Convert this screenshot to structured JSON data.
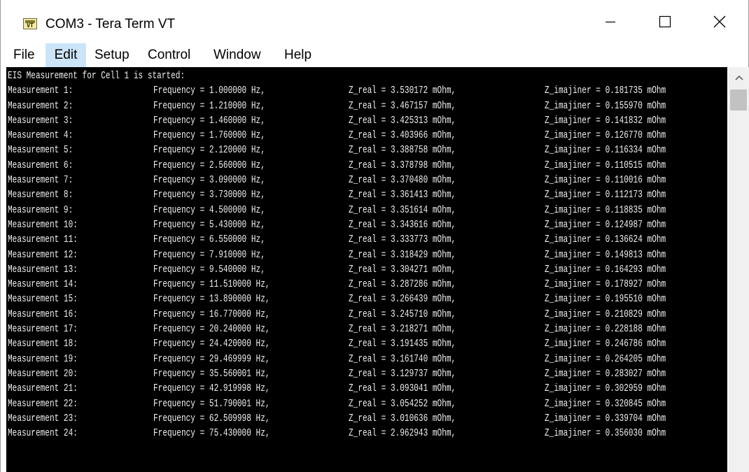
{
  "window": {
    "title": "COM3 - Tera Term VT",
    "icon_text": "VT",
    "icon": "teraterm-app-icon",
    "controls": {
      "minimize_icon": "minimize-icon",
      "maximize_icon": "maximize-icon",
      "close_icon": "close-icon"
    }
  },
  "menu": {
    "items": [
      {
        "label": "File"
      },
      {
        "label": "Edit",
        "selected": true
      },
      {
        "label": "Setup"
      },
      {
        "label": "Control"
      },
      {
        "label": "Window"
      },
      {
        "label": "Help"
      }
    ],
    "selected_color": "#cce4f7"
  },
  "terminal": {
    "background": "#000000",
    "foreground": "#f0f0f0",
    "header": "EIS Measurement for Cell 1 is started:",
    "rows": [
      {
        "label": "Measurement 1:",
        "freq": "Frequency = 1.000000 Hz,",
        "real": "Z_real = 3.530172 mOhm,",
        "imag": "Z_imajiner = 0.181735 mOhm"
      },
      {
        "label": "Measurement 2:",
        "freq": "Frequency = 1.210000 Hz,",
        "real": "Z_real = 3.467157 mOhm,",
        "imag": "Z_imajiner = 0.155970 mOhm"
      },
      {
        "label": "Measurement 3:",
        "freq": "Frequency = 1.460000 Hz,",
        "real": "Z_real = 3.425313 mOhm,",
        "imag": "Z_imajiner = 0.141832 mOhm"
      },
      {
        "label": "Measurement 4:",
        "freq": "Frequency = 1.760000 Hz,",
        "real": "Z_real = 3.403966 mOhm,",
        "imag": "Z_imajiner = 0.126770 mOhm"
      },
      {
        "label": "Measurement 5:",
        "freq": "Frequency = 2.120000 Hz,",
        "real": "Z_real = 3.388758 mOhm,",
        "imag": "Z_imajiner = 0.116334 mOhm"
      },
      {
        "label": "Measurement 6:",
        "freq": "Frequency = 2.560000 Hz,",
        "real": "Z_real = 3.378798 mOhm,",
        "imag": "Z_imajiner = 0.110515 mOhm"
      },
      {
        "label": "Measurement 7:",
        "freq": "Frequency = 3.090000 Hz,",
        "real": "Z_real = 3.370480 mOhm,",
        "imag": "Z_imajiner = 0.110016 mOhm"
      },
      {
        "label": "Measurement 8:",
        "freq": "Frequency = 3.730000 Hz,",
        "real": "Z_real = 3.361413 mOhm,",
        "imag": "Z_imajiner = 0.112173 mOhm"
      },
      {
        "label": "Measurement 9:",
        "freq": "Frequency = 4.500000 Hz,",
        "real": "Z_real = 3.351614 mOhm,",
        "imag": "Z_imajiner = 0.118835 mOhm"
      },
      {
        "label": "Measurement 10:",
        "freq": "Frequency = 5.430000 Hz,",
        "real": "Z_real = 3.343616 mOhm,",
        "imag": "Z_imajiner = 0.124987 mOhm"
      },
      {
        "label": "Measurement 11:",
        "freq": "Frequency = 6.550000 Hz,",
        "real": "Z_real = 3.333773 mOhm,",
        "imag": "Z_imajiner = 0.136624 mOhm"
      },
      {
        "label": "Measurement 12:",
        "freq": "Frequency = 7.910000 Hz,",
        "real": "Z_real = 3.318429 mOhm,",
        "imag": "Z_imajiner = 0.149813 mOhm"
      },
      {
        "label": "Measurement 13:",
        "freq": "Frequency = 9.540000 Hz,",
        "real": "Z_real = 3.304271 mOhm,",
        "imag": "Z_imajiner = 0.164293 mOhm"
      },
      {
        "label": "Measurement 14:",
        "freq": "Frequency = 11.510000 Hz,",
        "real": "Z_real = 3.287286 mOhm,",
        "imag": "Z_imajiner = 0.178927 mOhm"
      },
      {
        "label": "Measurement 15:",
        "freq": "Frequency = 13.890000 Hz,",
        "real": "Z_real = 3.266439 mOhm,",
        "imag": "Z_imajiner = 0.195510 mOhm"
      },
      {
        "label": "Measurement 16:",
        "freq": "Frequency = 16.770000 Hz,",
        "real": "Z_real = 3.245710 mOhm,",
        "imag": "Z_imajiner = 0.210829 mOhm"
      },
      {
        "label": "Measurement 17:",
        "freq": "Frequency = 20.240000 Hz,",
        "real": "Z_real = 3.218271 mOhm,",
        "imag": "Z_imajiner = 0.228188 mOhm"
      },
      {
        "label": "Measurement 18:",
        "freq": "Frequency = 24.420000 Hz,",
        "real": "Z_real = 3.191435 mOhm,",
        "imag": "Z_imajiner = 0.246786 mOhm"
      },
      {
        "label": "Measurement 19:",
        "freq": "Frequency = 29.469999 Hz,",
        "real": "Z_real = 3.161740 mOhm,",
        "imag": "Z_imajiner = 0.264205 mOhm"
      },
      {
        "label": "Measurement 20:",
        "freq": "Frequency = 35.560001 Hz,",
        "real": "Z_real = 3.129737 mOhm,",
        "imag": "Z_imajiner = 0.283027 mOhm"
      },
      {
        "label": "Measurement 21:",
        "freq": "Frequency = 42.919998 Hz,",
        "real": "Z_real = 3.093041 mOhm,",
        "imag": "Z_imajiner = 0.302959 mOhm"
      },
      {
        "label": "Measurement 22:",
        "freq": "Frequency = 51.790001 Hz,",
        "real": "Z_real = 3.054252 mOhm,",
        "imag": "Z_imajiner = 0.320845 mOhm"
      },
      {
        "label": "Measurement 23:",
        "freq": "Frequency = 62.509998 Hz,",
        "real": "Z_real = 3.010636 mOhm,",
        "imag": "Z_imajiner = 0.339704 mOhm"
      },
      {
        "label": "Measurement 24:",
        "freq": "Frequency = 75.430000 Hz,",
        "real": "Z_real = 2.962943 mOhm,",
        "imag": "Z_imajiner = 0.356030 mOhm"
      }
    ]
  },
  "scrollbar": {
    "up_icon": "scroll-up-arrow-icon"
  }
}
